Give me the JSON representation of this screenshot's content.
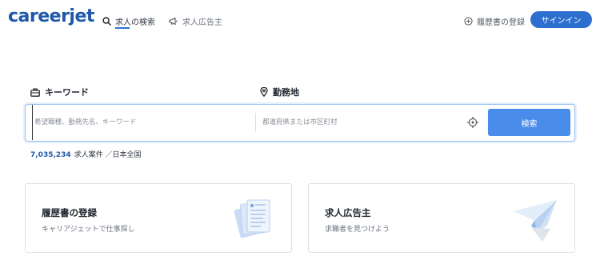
{
  "header": {
    "logo": "careerjet",
    "nav": {
      "search": "求人の検索",
      "employer": "求人広告主"
    },
    "resume_link": "履歴書の登録",
    "signin": "サインイン"
  },
  "search": {
    "keyword_label": "キーワード",
    "location_label": "勤務地",
    "keyword_placeholder": "希望職種、勤務先名、キーワード",
    "location_placeholder": "都道府県または市区町村",
    "button": "検索"
  },
  "stats": {
    "count": "7,035,234",
    "suffix": "求人案件 ／日本全国"
  },
  "cards": [
    {
      "title": "履歴書の登録",
      "subtitle": "キャリアジェットで仕事探し",
      "icon": "documents-illustration"
    },
    {
      "title": "求人広告主",
      "subtitle": "求職者を見つけよう",
      "icon": "paper-plane-illustration"
    }
  ],
  "colors": {
    "brand": "#1e58a8",
    "button": "#4a8cea",
    "signin": "#2d6fcf"
  }
}
